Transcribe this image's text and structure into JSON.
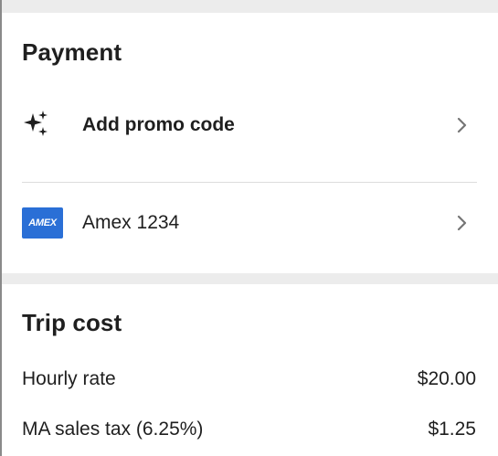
{
  "payment": {
    "title": "Payment",
    "promo": {
      "label": "Add promo code",
      "icon": "sparkle-icon"
    },
    "card": {
      "brand": "AMEX",
      "label": "Amex 1234",
      "brand_color": "#2a6fd6"
    }
  },
  "trip_cost": {
    "title": "Trip cost",
    "lines": [
      {
        "label": "Hourly rate",
        "amount": "$20.00"
      },
      {
        "label": "MA sales tax (6.25%)",
        "amount": "$1.25"
      }
    ]
  },
  "colors": {
    "separator_band": "#ececec",
    "divider": "#dcdcdc",
    "chevron": "#757575"
  }
}
